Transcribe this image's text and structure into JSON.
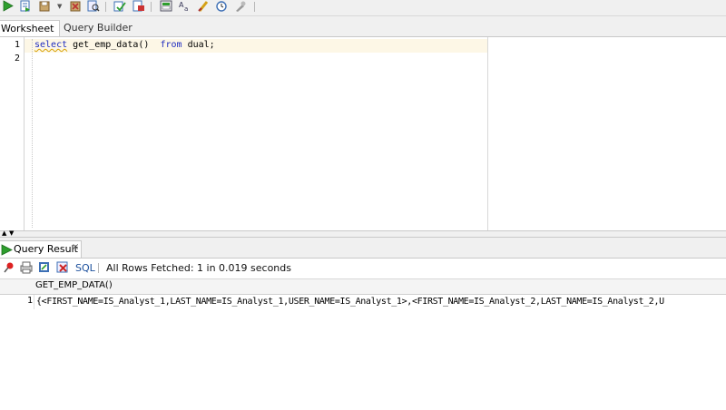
{
  "toolbar": {
    "buttons": [
      {
        "icon": "run-statement-icon",
        "color": "#2e9e2e"
      },
      {
        "icon": "run-script-icon",
        "color": "#3d6fb5"
      },
      {
        "icon": "commit-icon",
        "color": "#7a5a2a"
      },
      {
        "icon": "dropdown-arrow-icon"
      },
      {
        "icon": "rollback-icon",
        "color": "#b33"
      },
      {
        "icon": "explain-plan-icon",
        "color": "#3d6fb5"
      },
      {
        "icon": "autotrace-icon",
        "color": "#2e9e2e"
      },
      {
        "icon": "unshared-sql-icon",
        "color": "#c33"
      },
      {
        "icon": "sql-tuning-icon",
        "color": "#556"
      },
      {
        "icon": "to-upper-lower-icon",
        "color": "#556"
      },
      {
        "icon": "clear-icon",
        "color": "#d4a017"
      },
      {
        "icon": "history-icon",
        "color": "#3d6fb5"
      },
      {
        "icon": "format-icon",
        "color": "#777"
      }
    ]
  },
  "editor_tabs": [
    {
      "label": "Worksheet",
      "active": true
    },
    {
      "label": "Query Builder",
      "active": false
    }
  ],
  "editor": {
    "line_numbers": [
      "1",
      "2"
    ],
    "code": {
      "keyword_select": "select",
      "function_call": " get_emp_data()  ",
      "keyword_from": "from",
      "rest": " dual;"
    }
  },
  "result_tab": {
    "label": "Query Result",
    "close": "×"
  },
  "result_toolbar": {
    "sql_label": "SQL",
    "status": "All Rows Fetched: 1 in 0.019 seconds"
  },
  "grid": {
    "column_header": "GET_EMP_DATA()",
    "rows": [
      {
        "num": "1",
        "value": "{<FIRST_NAME=IS_Analyst_1,LAST_NAME=IS_Analyst_1,USER_NAME=IS_Analyst_1>,<FIRST_NAME=IS_Analyst_2,LAST_NAME=IS_Analyst_2,U"
      }
    ]
  }
}
